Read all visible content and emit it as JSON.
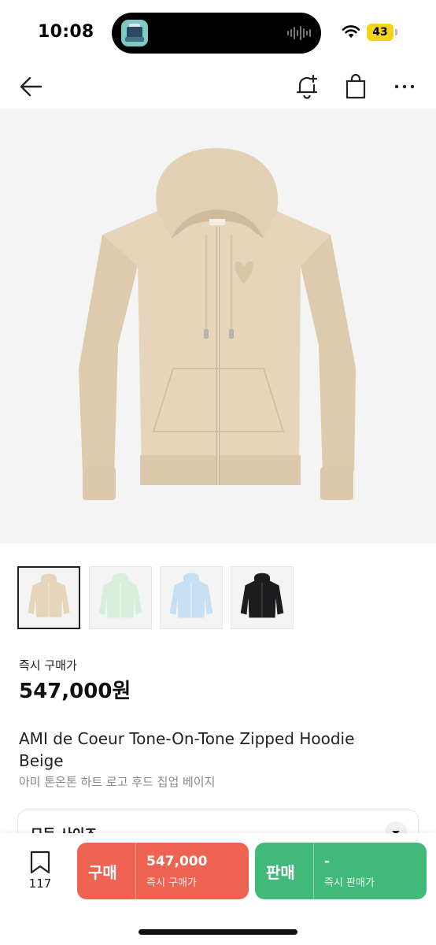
{
  "status_bar": {
    "time": "10:08",
    "battery": "43",
    "icons": [
      "app-icon",
      "audio-wave-icon",
      "wifi-icon",
      "battery-icon"
    ]
  },
  "nav": {
    "icons": [
      "back-arrow-icon",
      "bell-plus-icon",
      "shopping-bag-icon",
      "more-icon"
    ]
  },
  "product": {
    "images": {
      "hero": "hoodie-beige",
      "thumbnails": [
        {
          "color": "#e6d5bb",
          "name": "beige"
        },
        {
          "color": "#d7eedd",
          "name": "mint"
        },
        {
          "color": "#c6dff2",
          "name": "sky-blue"
        },
        {
          "color": "#1d1d1f",
          "name": "black"
        }
      ]
    },
    "price_label": "즉시 구매가",
    "price": "547,000원",
    "title_en": "AMI de Coeur Tone-On-Tone Zipped Hoodie Beige",
    "title_ko": "아미 톤온톤 하트 로고 후드 집업 베이지"
  },
  "size_select": {
    "label": "모든 사이즈"
  },
  "bottom_bar": {
    "bookmark_count": "117",
    "buy": {
      "label": "구매",
      "price": "547,000",
      "sub": "즉시 구매가",
      "color": "#ee6351"
    },
    "sell": {
      "label": "판매",
      "price": "-",
      "sub": "즉시 판매가",
      "color": "#41b979"
    }
  }
}
